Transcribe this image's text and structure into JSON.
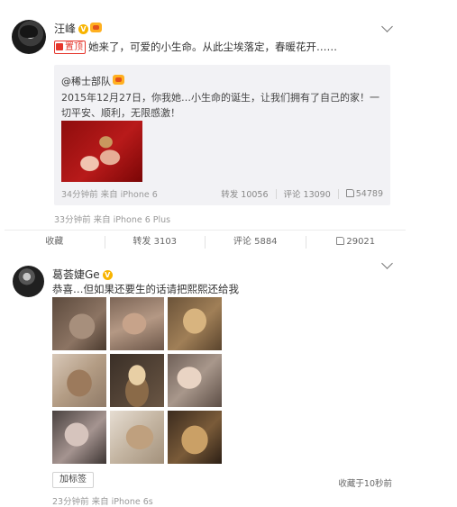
{
  "post1": {
    "author": "汪峰",
    "pin_label": "置顶",
    "text": "她来了，可爱的小生命。从此尘埃落定，春暖花开……",
    "repost": {
      "author": "@稀士部队",
      "text": "2015年12月27日，你我她…小生命的诞生，让我们拥有了自己的家！一切平安、顺利，无限感激！",
      "time_source": "34分钟前 来自 iPhone 6",
      "forward": "转发 10056",
      "comment": "评论 13090",
      "like": "54789"
    },
    "time_source": "33分钟前 来自 iPhone 6 Plus",
    "actions": {
      "favorite": "收藏",
      "forward": "转发 3103",
      "comment": "评论 5884",
      "like": "29021"
    }
  },
  "post2": {
    "author": "葛荟婕Ge",
    "text": "恭喜…但如果还要生的话请把熙熙还给我",
    "add_tag": "加标签",
    "collect_time": "收藏于10秒前",
    "time_source": "23分钟前 来自 iPhone 6s"
  }
}
